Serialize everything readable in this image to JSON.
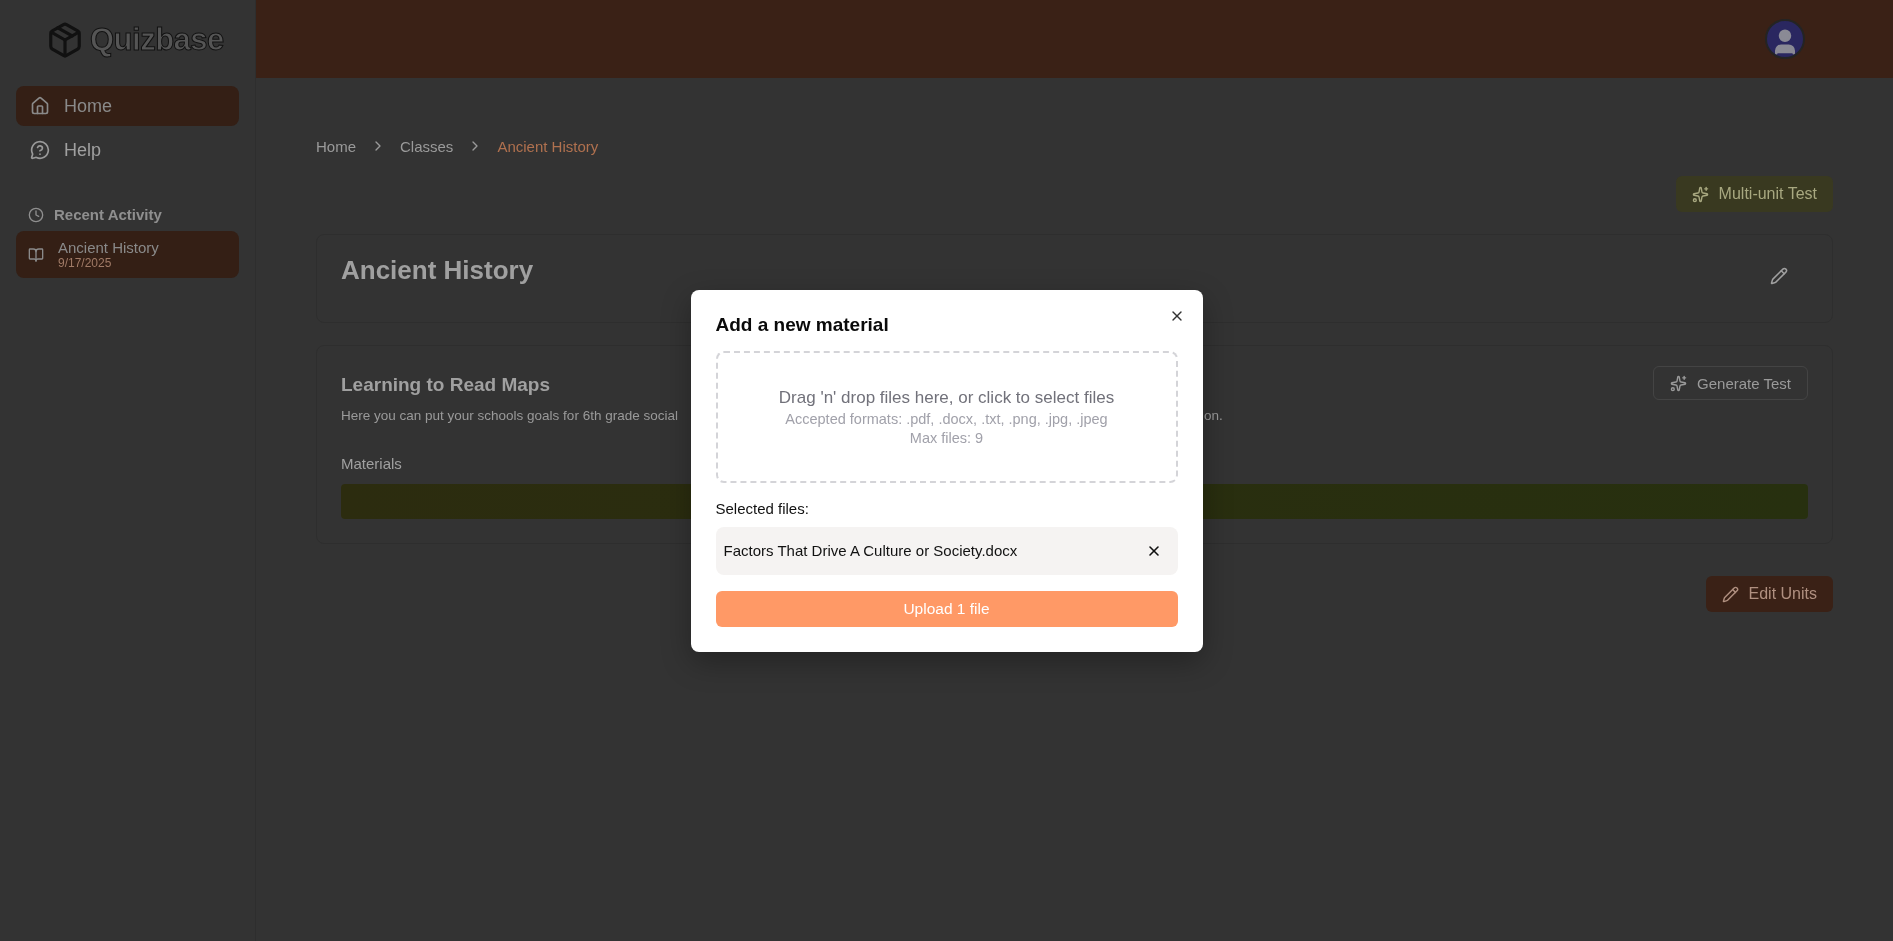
{
  "app": {
    "logo": "Quizbase"
  },
  "sidebar": {
    "nav": [
      {
        "label": "Home",
        "selected": true
      },
      {
        "label": "Help",
        "selected": false
      }
    ],
    "recent_heading": "Recent Activity",
    "recent": [
      {
        "title": "Ancient History",
        "date": "9/17/2025",
        "selected": true
      }
    ]
  },
  "breadcrumb": [
    {
      "label": "Home",
      "current": false
    },
    {
      "label": "Classes",
      "current": false
    },
    {
      "label": "Ancient History",
      "current": true
    }
  ],
  "actions": {
    "multi_unit": "Multi-unit Test",
    "edit_units": "Edit Units"
  },
  "class_card": {
    "title": "Ancient History"
  },
  "unit": {
    "title": "Learning to Read Maps",
    "description_start": "Here you can put your schools goals for 6th grade social",
    "description_end": "on.",
    "generate": "Generate Test",
    "materials_label": "Materials"
  },
  "dialog": {
    "title": "Add a new material",
    "drop_text": "Drag 'n' drop files here, or click to select files",
    "formats": "Accepted formats: .pdf, .docx, .txt, .png, .jpg, .jpeg",
    "max_files": "Max files: 9",
    "selected_label": "Selected files:",
    "files": [
      {
        "name": "Factors That Drive A Culture or Society.docx"
      }
    ],
    "upload": "Upload 1 file"
  }
}
